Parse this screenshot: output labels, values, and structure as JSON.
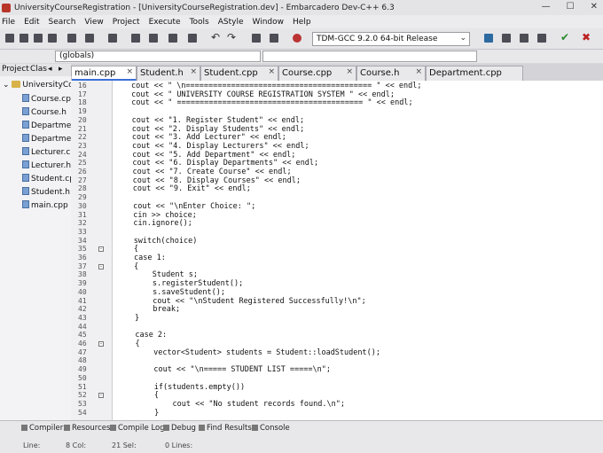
{
  "window": {
    "title": "UniversityCourseRegistration - [UniversityCourseRegistration.dev] - Embarcadero Dev-C++ 6.3"
  },
  "menu": [
    "File",
    "Edit",
    "Search",
    "View",
    "Project",
    "Execute",
    "Tools",
    "AStyle",
    "Window",
    "Help"
  ],
  "toolbar": {
    "compiler": "TDM-GCC 9.2.0 64-bit Release"
  },
  "classbar": {
    "scope": "(globals)"
  },
  "left_tabs": {
    "project": "Project",
    "classes": "Clas"
  },
  "tabs": [
    {
      "label": "main.cpp",
      "active": true
    },
    {
      "label": "Student.h",
      "active": false
    },
    {
      "label": "Student.cpp",
      "active": false
    },
    {
      "label": "Course.cpp",
      "active": false
    },
    {
      "label": "Course.h",
      "active": false
    },
    {
      "label": "Department.cpp",
      "active": false
    }
  ],
  "project_tree": {
    "root": "UniversityCou",
    "files": [
      "Course.cp",
      "Course.h",
      "Departme",
      "Departme",
      "Lecturer.c",
      "Lecturer.h",
      "Student.cp",
      "Student.h",
      "main.cpp"
    ]
  },
  "line_numbers": [
    "16",
    "17",
    "18",
    "19",
    "20",
    "21",
    "22",
    "23",
    "24",
    "25",
    "26",
    "27",
    "28",
    "29",
    "30",
    "31",
    "32",
    "33",
    "34",
    "35",
    "36",
    "37",
    "38",
    "39",
    "40",
    "41",
    "42",
    "43",
    "44",
    "45",
    "46",
    "47",
    "48",
    "49",
    "50",
    "51",
    "52",
    "53",
    "54"
  ],
  "code_lines": [
    "cout << \" \\n========================================= \" << endl;",
    "cout << \" UNIVERSITY COURSE REGISTRATION SYSTEM \" << endl;",
    "cout << \" ========================================= \" << endl;",
    "",
    "cout << \"1. Register Student\" << endl;",
    "cout << \"2. Display Students\" << endl;",
    "cout << \"3. Add Lecturer\" << endl;",
    "cout << \"4. Display Lecturers\" << endl;",
    "cout << \"5. Add Department\" << endl;",
    "cout << \"6. Display Departments\" << endl;",
    "cout << \"7. Create Course\" << endl;",
    "cout << \"8. Display Courses\" << endl;",
    "cout << \"9. Exit\" << endl;",
    "",
    "cout << \"\\nEnter Choice: \";",
    "cin >> choice;",
    "cin.ignore();",
    "",
    "switch(choice)",
    "{",
    "case 1:",
    "{",
    "    Student s;",
    "    s.registerStudent();",
    "    s.saveStudent();",
    "    cout << \"\\nStudent Registered Successfully!\\n\";",
    "    break;",
    "}",
    "",
    "case 2:",
    "{",
    "    vector<Student> students = Student::loadStudent();",
    "",
    "    cout << \"\\n===== STUDENT LIST =====\\n\";",
    "",
    "    if(students.empty())",
    "    {",
    "        cout << \"No student records found.\\n\";",
    "    }"
  ],
  "bottom_tabs": [
    "Compiler",
    "Resources",
    "Compile Log",
    "Debug",
    "Find Results",
    "Console"
  ],
  "status": {
    "line": "Line:",
    "col": "8 Col:",
    "sel": "21 Sel:",
    "lines": "0 Lines:"
  }
}
